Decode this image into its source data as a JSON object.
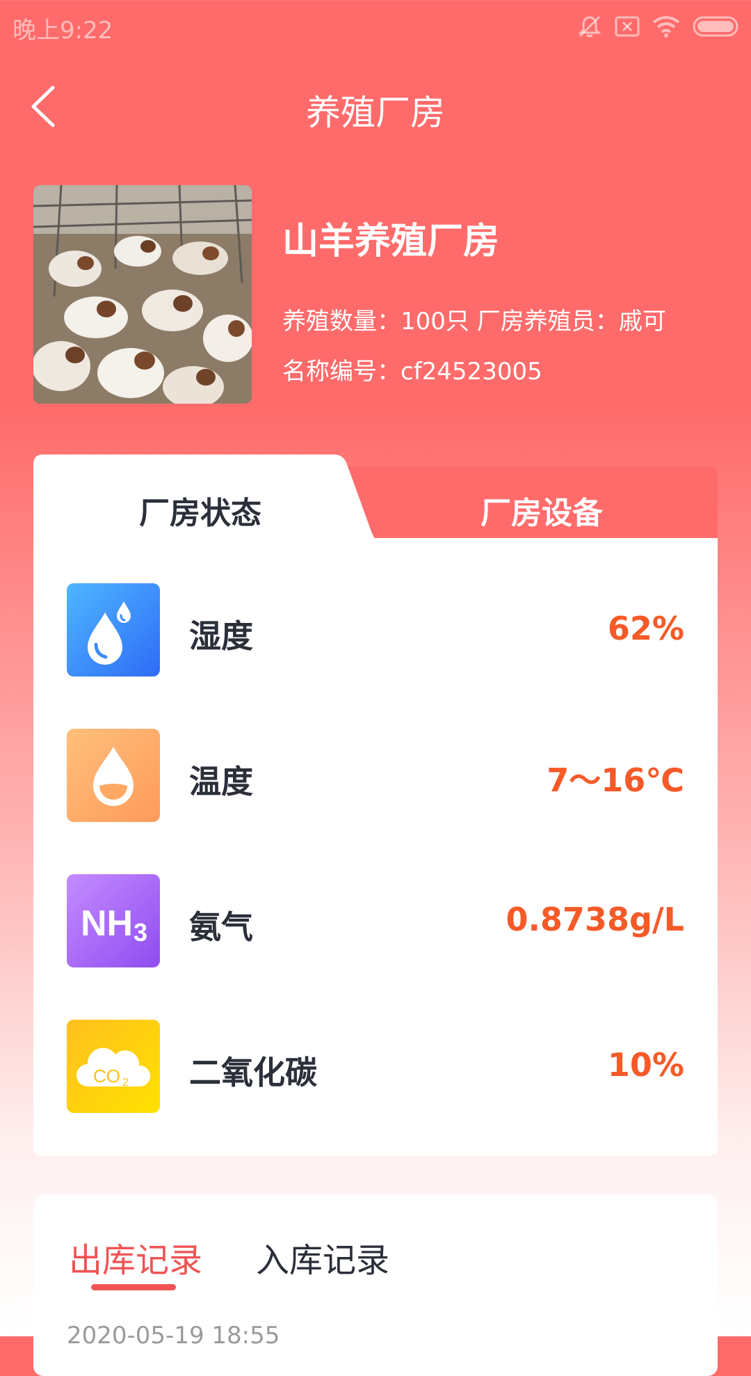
{
  "status_bar": {
    "time": "晚上9:22"
  },
  "header": {
    "back_icon": "back-arrow-icon",
    "title": "养殖厂房"
  },
  "farm": {
    "name": "山羊养殖厂房",
    "info_line1": "养殖数量：100只 厂房养殖员：戚可",
    "info_line2": "名称编号：cf24523005"
  },
  "tabs": [
    {
      "label": "厂房状态",
      "active": true
    },
    {
      "label": "厂房设备",
      "active": false
    }
  ],
  "metrics": [
    {
      "icon": "humidity-drops-icon",
      "label": "湿度",
      "value": "62%"
    },
    {
      "icon": "temperature-drop-icon",
      "label": "温度",
      "value": "7～16℃"
    },
    {
      "icon": "nh3-icon",
      "label": "氨气",
      "value": "0.8738g/L"
    },
    {
      "icon": "co2-cloud-icon",
      "label": "二氧化碳",
      "value": "10%"
    }
  ],
  "records": {
    "tabs": [
      {
        "label": "出库记录",
        "active": true
      },
      {
        "label": "入库记录",
        "active": false
      }
    ],
    "first_date": "2020-05-19 18:55"
  },
  "colors": {
    "brand": "#FF6B6B",
    "value_orange": "#F55A28",
    "active_tab_red": "#F05454",
    "dark_text": "#2B2F3A"
  }
}
